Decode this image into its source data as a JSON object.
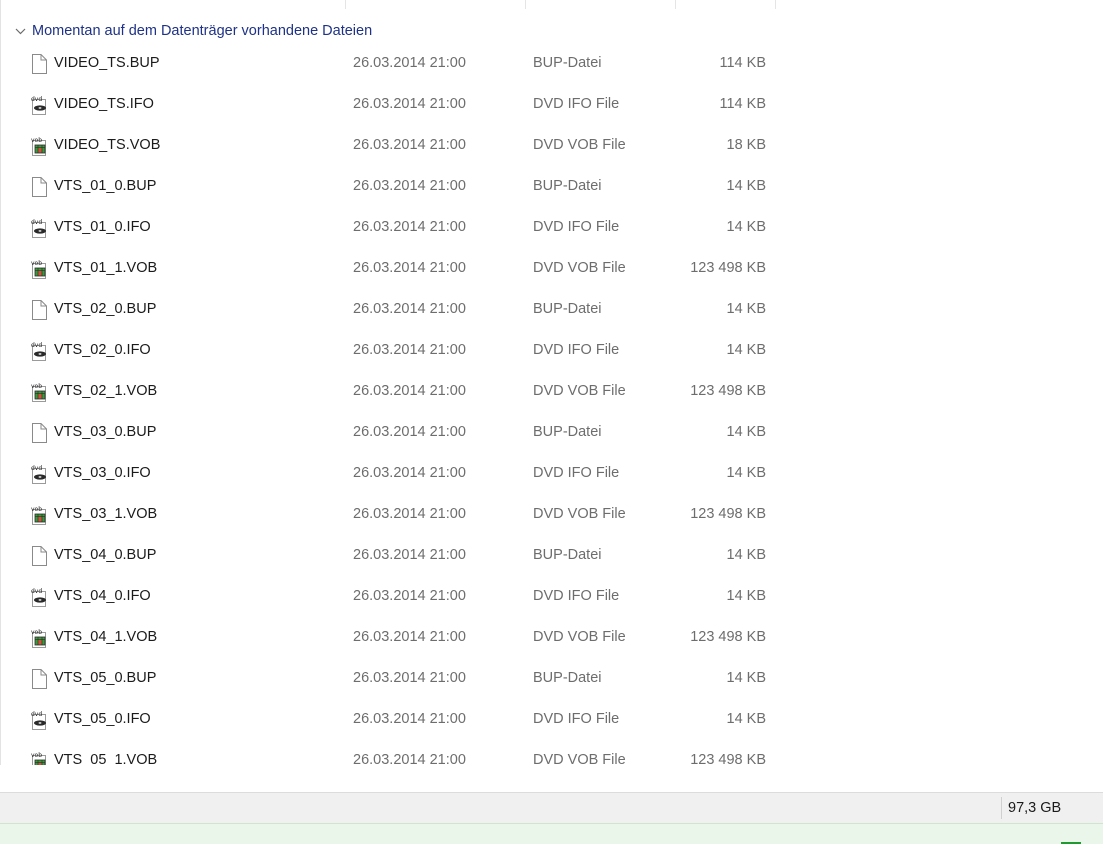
{
  "group": {
    "label": "Momentan auf dem Datenträger vorhandene Dateien"
  },
  "files": [
    {
      "name": "VIDEO_TS.BUP",
      "date": "26.03.2014 21:00",
      "type": "BUP-Datei",
      "size": "114 KB",
      "icon": "blank-file-icon"
    },
    {
      "name": "VIDEO_TS.IFO",
      "date": "26.03.2014 21:00",
      "type": "DVD IFO File",
      "size": "114 KB",
      "icon": "dvd-ifo-icon"
    },
    {
      "name": "VIDEO_TS.VOB",
      "date": "26.03.2014 21:00",
      "type": "DVD VOB File",
      "size": "18 KB",
      "icon": "dvd-vob-icon"
    },
    {
      "name": "VTS_01_0.BUP",
      "date": "26.03.2014 21:00",
      "type": "BUP-Datei",
      "size": "14 KB",
      "icon": "blank-file-icon"
    },
    {
      "name": "VTS_01_0.IFO",
      "date": "26.03.2014 21:00",
      "type": "DVD IFO File",
      "size": "14 KB",
      "icon": "dvd-ifo-icon"
    },
    {
      "name": "VTS_01_1.VOB",
      "date": "26.03.2014 21:00",
      "type": "DVD VOB File",
      "size": "123 498 KB",
      "icon": "dvd-vob-icon"
    },
    {
      "name": "VTS_02_0.BUP",
      "date": "26.03.2014 21:00",
      "type": "BUP-Datei",
      "size": "14 KB",
      "icon": "blank-file-icon"
    },
    {
      "name": "VTS_02_0.IFO",
      "date": "26.03.2014 21:00",
      "type": "DVD IFO File",
      "size": "14 KB",
      "icon": "dvd-ifo-icon"
    },
    {
      "name": "VTS_02_1.VOB",
      "date": "26.03.2014 21:00",
      "type": "DVD VOB File",
      "size": "123 498 KB",
      "icon": "dvd-vob-icon"
    },
    {
      "name": "VTS_03_0.BUP",
      "date": "26.03.2014 21:00",
      "type": "BUP-Datei",
      "size": "14 KB",
      "icon": "blank-file-icon"
    },
    {
      "name": "VTS_03_0.IFO",
      "date": "26.03.2014 21:00",
      "type": "DVD IFO File",
      "size": "14 KB",
      "icon": "dvd-ifo-icon"
    },
    {
      "name": "VTS_03_1.VOB",
      "date": "26.03.2014 21:00",
      "type": "DVD VOB File",
      "size": "123 498 KB",
      "icon": "dvd-vob-icon"
    },
    {
      "name": "VTS_04_0.BUP",
      "date": "26.03.2014 21:00",
      "type": "BUP-Datei",
      "size": "14 KB",
      "icon": "blank-file-icon"
    },
    {
      "name": "VTS_04_0.IFO",
      "date": "26.03.2014 21:00",
      "type": "DVD IFO File",
      "size": "14 KB",
      "icon": "dvd-ifo-icon"
    },
    {
      "name": "VTS_04_1.VOB",
      "date": "26.03.2014 21:00",
      "type": "DVD VOB File",
      "size": "123 498 KB",
      "icon": "dvd-vob-icon"
    },
    {
      "name": "VTS_05_0.BUP",
      "date": "26.03.2014 21:00",
      "type": "BUP-Datei",
      "size": "14 KB",
      "icon": "blank-file-icon"
    },
    {
      "name": "VTS_05_0.IFO",
      "date": "26.03.2014 21:00",
      "type": "DVD IFO File",
      "size": "14 KB",
      "icon": "dvd-ifo-icon"
    },
    {
      "name": "VTS_05_1.VOB",
      "date": "26.03.2014 21:00",
      "type": "DVD VOB File",
      "size": "123 498 KB",
      "icon": "dvd-vob-icon"
    }
  ],
  "statusbar": {
    "free_space": "97,3 GB"
  },
  "colors": {
    "group_header": "#1e3287",
    "progress_green": "#1f9a2f"
  }
}
